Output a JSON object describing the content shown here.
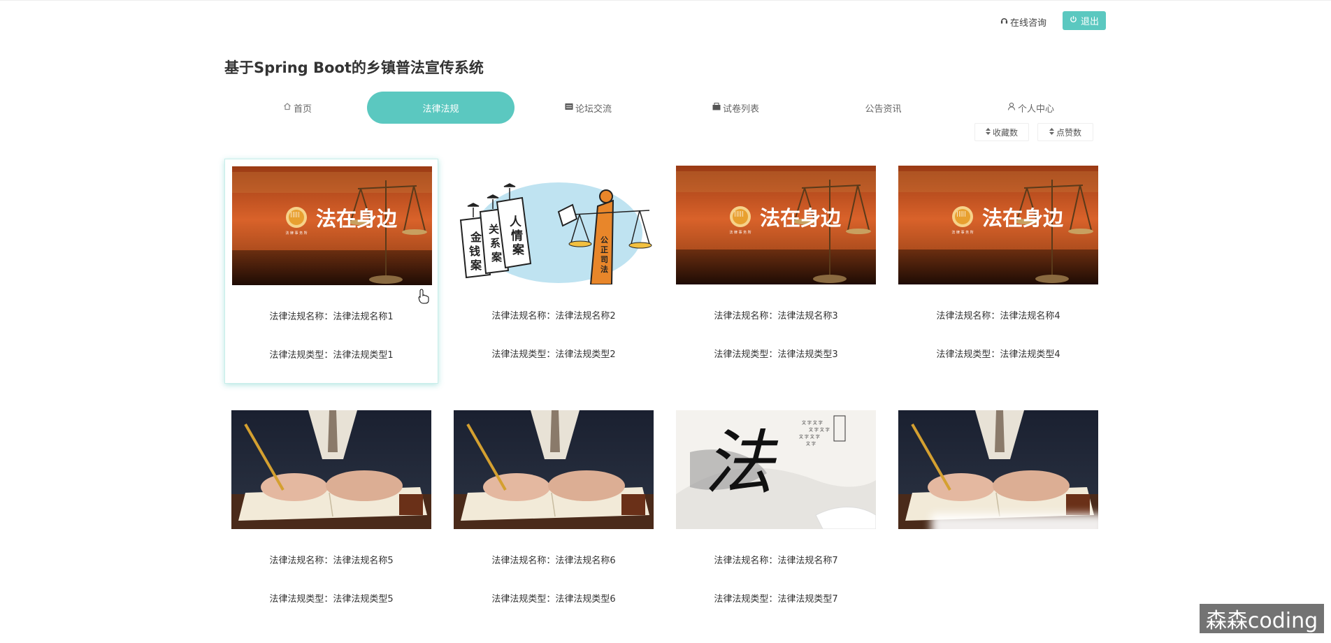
{
  "header": {
    "consult_label": "在线咨询",
    "logout_label": "退出",
    "title": "基于Spring Boot的乡镇普法宣传系统"
  },
  "nav": {
    "items": [
      {
        "label": "首页",
        "icon": "home-icon"
      },
      {
        "label": "法律法规",
        "icon": ""
      },
      {
        "label": "论坛交流",
        "icon": "forum-icon"
      },
      {
        "label": "试卷列表",
        "icon": "paper-icon"
      },
      {
        "label": "公告资讯",
        "icon": ""
      },
      {
        "label": "个人中心",
        "icon": "user-icon"
      }
    ],
    "active_index": 1
  },
  "sort": {
    "favorites_label": "收藏数",
    "likes_label": "点赞数"
  },
  "cards": [
    {
      "name": "法律法规名称：法律法规名称1",
      "type": "法律法规类型：法律法规类型1",
      "image": "scales-banner",
      "banner_text": "法在身边"
    },
    {
      "name": "法律法规名称：法律法规名称2",
      "type": "法律法规类型：法律法规类型2",
      "image": "cartoon-justice",
      "banner_text": "公正司法"
    },
    {
      "name": "法律法规名称：法律法规名称3",
      "type": "法律法规类型：法律法规类型3",
      "image": "scales-banner",
      "banner_text": "法在身边"
    },
    {
      "name": "法律法规名称：法律法规名称4",
      "type": "法律法规类型：法律法规类型4",
      "image": "scales-banner",
      "banner_text": "法在身边"
    },
    {
      "name": "法律法规名称：法律法规名称5",
      "type": "法律法规类型：法律法规类型5",
      "image": "writing-hands",
      "banner_text": ""
    },
    {
      "name": "法律法规名称：法律法规名称6",
      "type": "法律法规类型：法律法规类型6",
      "image": "writing-hands",
      "banner_text": ""
    },
    {
      "name": "法律法规名称：法律法规名称7",
      "type": "法律法规类型：法律法规类型7",
      "image": "calligraphy",
      "banner_text": "法"
    },
    {
      "name": "",
      "type": "",
      "image": "writing-hands",
      "banner_text": ""
    }
  ],
  "watermark": "森森coding",
  "colors": {
    "accent": "#5bc8c0"
  }
}
